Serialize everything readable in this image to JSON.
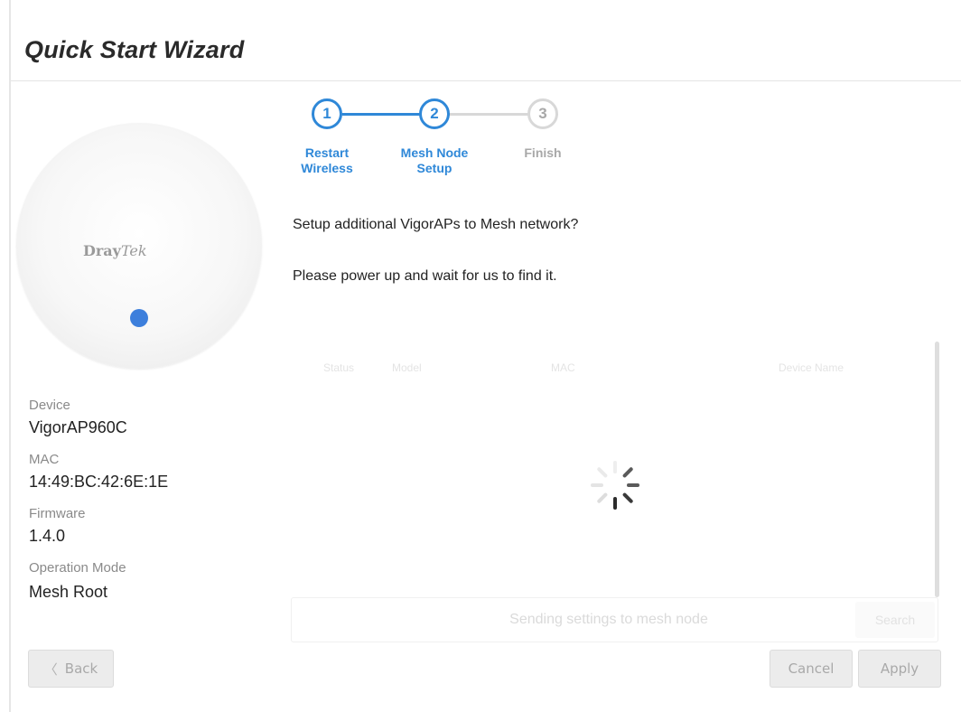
{
  "header": {
    "title": "Quick Start Wizard"
  },
  "device_image": {
    "logo_brand": "Dray",
    "logo_suffix": "Tek",
    "led_color": "#3d7fdc"
  },
  "device_info": [
    {
      "label": "Device",
      "value": "VigorAP960C"
    },
    {
      "label": "MAC",
      "value": "14:49:BC:42:6E:1E"
    },
    {
      "label": "Firmware",
      "value": "1.4.0"
    },
    {
      "label": "Operation Mode",
      "value": "Mesh Root"
    }
  ],
  "stepper": {
    "active_color": "#2f88d8",
    "inactive_color": "#d8d8d8",
    "current_step": 2,
    "steps": [
      {
        "number": "1",
        "line1": "Restart",
        "line2": "Wireless",
        "state": "complete"
      },
      {
        "number": "2",
        "line1": "Mesh Node",
        "line2": "Setup",
        "state": "active"
      },
      {
        "number": "3",
        "line1": "Finish",
        "line2": "",
        "state": "inactive"
      }
    ]
  },
  "main": {
    "question": "Setup additional VigorAPs to Mesh network?",
    "instruction": "Please power up and wait for us to find it."
  },
  "table": {
    "columns": [
      "Status",
      "Model",
      "MAC",
      "Device Name"
    ]
  },
  "loading": {
    "icon": "spinner-icon"
  },
  "search": {
    "status_text": "Sending settings to mesh node",
    "button_label": "Search"
  },
  "footer": {
    "back_label": "Back",
    "back_icon": "chevron-left-icon",
    "cancel_label": "Cancel",
    "apply_label": "Apply"
  }
}
